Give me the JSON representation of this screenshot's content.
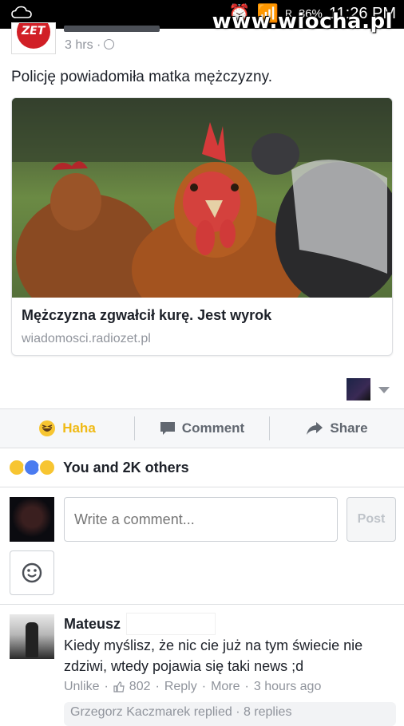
{
  "status_bar": {
    "battery_percent": "86%",
    "time": "11:26 PM",
    "signal_label": "R"
  },
  "watermark": "www.wiocha.pl",
  "post": {
    "page_logo_text": "ZET",
    "time": "3 hrs ·",
    "text": "Policję powiadomiła matka mężczyzny.",
    "link": {
      "title": "Mężczyzna zgwałcił kurę. Jest wyrok",
      "domain": "wiadomosci.radiozet.pl"
    }
  },
  "actions": {
    "haha_label": "Haha",
    "comment_label": "Comment",
    "share_label": "Share"
  },
  "reactions": {
    "icons": [
      "haha-icon",
      "like-icon",
      "wow-icon"
    ],
    "summary": "You and 2K others"
  },
  "composer": {
    "placeholder": "Write a comment...",
    "post_label": "Post"
  },
  "comment": {
    "author": "Mateusz",
    "text": "Kiedy myślisz, że nic cie już na tym świecie nie zdziwi, wtedy pojawia się taki news ;d",
    "unlike_label": "Unlike",
    "like_count": "802",
    "reply_label": "Reply",
    "more_label": "More",
    "time": "3 hours ago",
    "replies_preview": "Grzegorz Kaczmarek replied · 8 replies"
  },
  "colors": {
    "facebook_blue": "#4267b2",
    "haha_yellow": "#f0ba15",
    "meta_gray": "#90949c",
    "radio_zet_red": "#d11f26"
  }
}
